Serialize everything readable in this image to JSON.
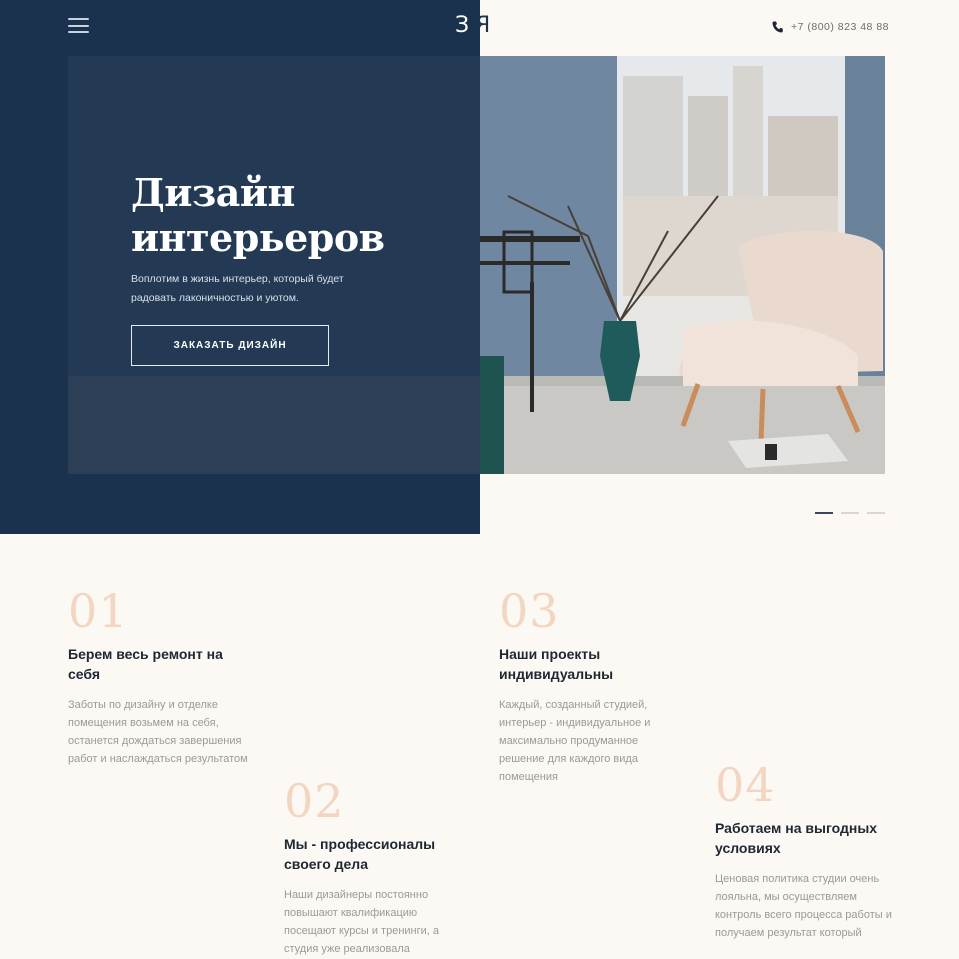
{
  "header": {
    "logo_left": "З",
    "logo_right": "R",
    "phone": "+7 (800) 823 48 88",
    "icons": {
      "menu": "hamburger-icon",
      "phone": "phone-icon"
    }
  },
  "hero": {
    "title": "Дизайн интерьеров",
    "subtitle": "Воплотим в жизнь интерьер, который будет радовать лаконичностью и уютом.",
    "button_label": "ЗАКАЗАТЬ ДИЗАЙН",
    "slides_total": 3,
    "slide_active": 1
  },
  "features": [
    {
      "number": "01",
      "title": "Берем весь ремонт на себя",
      "text": "Заботы по дизайну и отделке помещения возьмем на себя, останется дождаться завершения работ и наслаждаться результатом"
    },
    {
      "number": "02",
      "title": "Мы - профессионалы своего дела",
      "text": "Наши дизайнеры постоянно повышают квалификацию посещают курсы и тренинги, а студия уже реализовала"
    },
    {
      "number": "03",
      "title": "Наши проекты индивидуальны",
      "text": "Каждый, созданный студией, интерьер - индивидуальное и максимально продуманное решение для каждого вида помещения"
    },
    {
      "number": "04",
      "title": "Работаем на выгодных условиях",
      "text": "Ценовая политика студии очень лояльна, мы осуществляем контроль всего процесса работы и получаем результат который"
    }
  ],
  "colors": {
    "navy": "#1b324f",
    "background": "#fcf8f3",
    "accent_number": "#f3d6c2",
    "heading": "#1e2733",
    "body_text": "#9a9a9a"
  }
}
